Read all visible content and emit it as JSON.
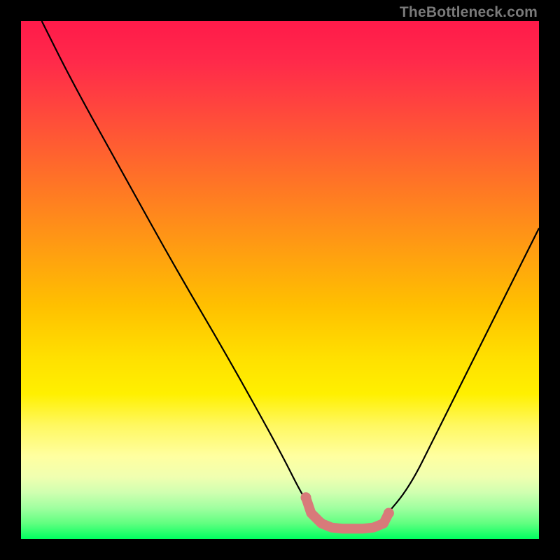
{
  "watermark": "TheBottleneck.com",
  "chart_data": {
    "type": "line",
    "title": "",
    "xlabel": "",
    "ylabel": "",
    "xlim": [
      0,
      100
    ],
    "ylim": [
      0,
      100
    ],
    "grid": false,
    "series": [
      {
        "name": "curve",
        "color": "#000000",
        "x": [
          4,
          10,
          20,
          30,
          40,
          50,
          54,
          56,
          58,
          60,
          62,
          64,
          66,
          68,
          70,
          75,
          80,
          85,
          90,
          95,
          100
        ],
        "y": [
          100,
          88,
          70,
          52,
          35,
          17,
          9,
          6,
          4,
          2.5,
          2,
          2,
          2,
          2.5,
          4,
          10,
          20,
          30,
          40,
          50,
          60
        ]
      }
    ],
    "markers": {
      "name": "flat-region",
      "color": "#d87a7a",
      "style": "round-caps",
      "x": [
        55,
        56,
        58,
        60,
        62,
        64,
        66,
        68,
        70,
        71
      ],
      "y": [
        8,
        5,
        3,
        2.2,
        2,
        2,
        2,
        2.2,
        3,
        5
      ]
    },
    "background": {
      "type": "vertical-gradient",
      "stops": [
        {
          "pos": 0,
          "color": "#ff1a4a"
        },
        {
          "pos": 50,
          "color": "#ffc000"
        },
        {
          "pos": 85,
          "color": "#ffff90"
        },
        {
          "pos": 100,
          "color": "#00ff60"
        }
      ]
    }
  }
}
